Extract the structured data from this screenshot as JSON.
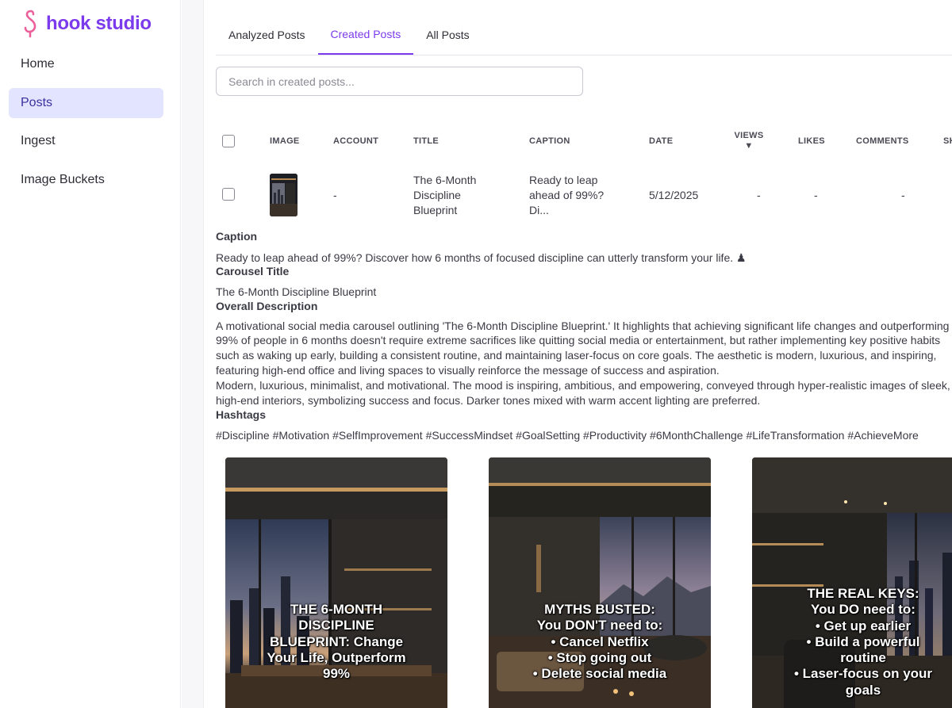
{
  "app": {
    "name": "hook studio"
  },
  "sidebar": {
    "items": [
      {
        "label": "Home",
        "active": false
      },
      {
        "label": "Posts",
        "active": true
      },
      {
        "label": "Ingest",
        "active": false
      },
      {
        "label": "Image Buckets",
        "active": false
      }
    ]
  },
  "tabs": [
    {
      "label": "Analyzed Posts",
      "active": false
    },
    {
      "label": "Created Posts",
      "active": true
    },
    {
      "label": "All Posts",
      "active": false
    }
  ],
  "search": {
    "placeholder": "Search in created posts..."
  },
  "table": {
    "headers": {
      "image": "IMAGE",
      "account": "ACCOUNT",
      "title": "TITLE",
      "caption": "CAPTION",
      "date": "DATE",
      "views": "VIEWS",
      "likes": "LIKES",
      "comments": "COMMENTS",
      "shares": "SH"
    },
    "sort_icon": "▼",
    "rows": [
      {
        "account": "-",
        "title": [
          "The 6-Month",
          "Discipline",
          "Blueprint"
        ],
        "caption": [
          "Ready to leap",
          "ahead of 99%?",
          "Di..."
        ],
        "date": "5/12/2025",
        "views": "-",
        "likes": "-",
        "comments": "-"
      }
    ]
  },
  "details": {
    "caption_label": "Caption",
    "caption": "Ready to leap ahead of 99%? Discover how 6 months of focused discipline can utterly transform your life. ♟",
    "carousel_title_label": "Carousel Title",
    "carousel_title": "The 6-Month Discipline Blueprint",
    "description_label": "Overall Description",
    "description_lines": [
      "A motivational social media carousel outlining 'The 6-Month Discipline Blueprint.' It highlights that achieving significant life changes and outperforming",
      "99% of people in 6 months doesn't require extreme sacrifices like quitting social media or entertainment, but rather implementing key positive habits",
      "such as waking up early, building a consistent routine, and maintaining laser-focus on core goals. The aesthetic is modern, luxurious, and inspiring,",
      "featuring high-end office and living spaces to visually reinforce the message of success and aspiration.",
      "Modern, luxurious, minimalist, and motivational. The mood is inspiring, ambitious, and empowering, conveyed through hyper-realistic images of sleek,",
      "high-end interiors, symbolizing success and focus. Darker tones mixed with warm accent lighting are preferred."
    ],
    "hashtags_label": "Hashtags",
    "hashtags": "#Discipline #Motivation #SelfImprovement #SuccessMindset #GoalSetting #Productivity #6MonthChallenge #LifeTransformation #AchieveMore"
  },
  "slides": [
    {
      "text": "THE 6-MONTH\nDISCIPLINE\nBLUEPRINT: Change\nYour Life, Outperform\n99%"
    },
    {
      "text": "MYTHS BUSTED:\nYou DON'T need to:\n• Cancel Netflix\n• Stop going out\n• Delete social media"
    },
    {
      "text": "THE REAL KEYS:\nYou DO need to:\n• Get up earlier\n• Build a powerful\nroutine\n• Laser-focus on your\ngoals"
    }
  ]
}
